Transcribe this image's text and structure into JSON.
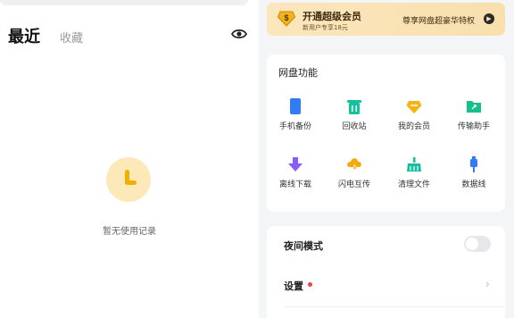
{
  "left": {
    "tabs": {
      "recent": "最近",
      "favorites": "收藏"
    },
    "empty_text": "暂无使用记录"
  },
  "vip": {
    "title": "开通超级会员",
    "subtitle": "新用户专享18元",
    "right_text": "尊享网盘超豪华特权"
  },
  "features": {
    "title": "网盘功能",
    "items": [
      {
        "label": "手机备份",
        "icon": "phone-backup-icon",
        "color": "#2f7cf6"
      },
      {
        "label": "回收站",
        "icon": "recycle-bin-icon",
        "color": "#12c29a"
      },
      {
        "label": "我的会员",
        "icon": "vip-diamond-icon",
        "color": "#f6b20f"
      },
      {
        "label": "传输助手",
        "icon": "transfer-folder-icon",
        "color": "#16c08a"
      },
      {
        "label": "离线下载",
        "icon": "offline-download-icon",
        "color": "#8b5cf6"
      },
      {
        "label": "闪电互传",
        "icon": "lightning-share-icon",
        "color": "#f6a90f"
      },
      {
        "label": "清理文件",
        "icon": "clean-files-icon",
        "color": "#15bfa0"
      },
      {
        "label": "数据线",
        "icon": "data-cable-icon",
        "color": "#2f7cf6"
      }
    ]
  },
  "settings": {
    "night_mode_label": "夜间模式",
    "night_mode_on": false,
    "settings_label": "设置"
  }
}
